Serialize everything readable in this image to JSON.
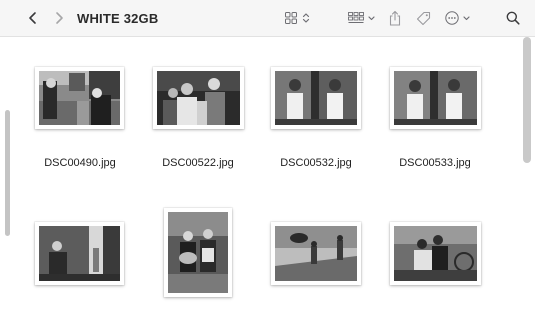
{
  "toolbar": {
    "title": "WHITE 32GB",
    "icons": [
      "chevron-left",
      "chevron-right",
      "grid-view",
      "up-down-chevron",
      "group-by",
      "chevron-down",
      "share",
      "tag",
      "more-ellipsis",
      "chevron-down",
      "search"
    ]
  },
  "files": [
    {
      "name": "DSC00490.jpg"
    },
    {
      "name": "DSC00522.jpg"
    },
    {
      "name": "DSC00532.jpg"
    },
    {
      "name": "DSC00533.jpg"
    },
    {
      "name": ""
    },
    {
      "name": ""
    },
    {
      "name": ""
    },
    {
      "name": ""
    }
  ],
  "colors": {
    "toolbar_bg": "#f6f6f6",
    "content_bg": "#ffffff",
    "icon": "#6e6e73"
  }
}
